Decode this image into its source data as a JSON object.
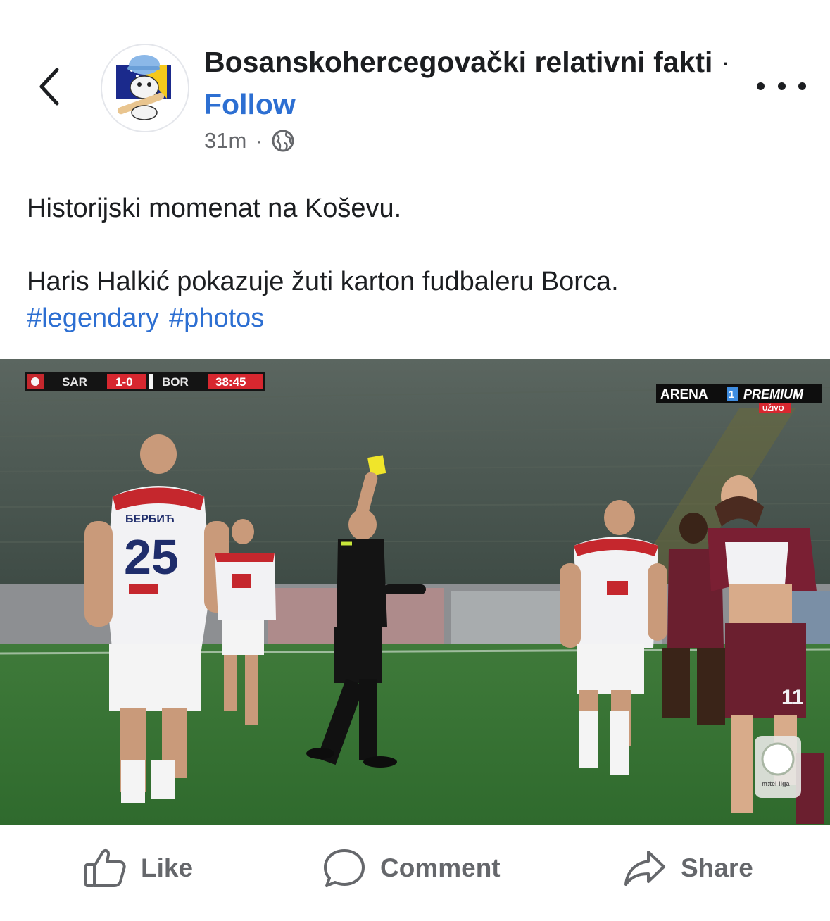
{
  "header": {
    "page_name": "Bosanskohercegovački relativni fakti",
    "separator": "·",
    "follow_label": "Follow",
    "time": "31m",
    "meta_dot": "·",
    "audience_icon": "globe-icon"
  },
  "post": {
    "line1": "Historijski momenat na Koševu.",
    "line2": "Haris Halkić pokazuje žuti karton fudbaleru Borca.",
    "hashtags": [
      "#legendary",
      "#photos"
    ]
  },
  "photo": {
    "scoreboard": {
      "home": "SAR",
      "score": "1-0",
      "away": "BOR",
      "clock": "38:45"
    },
    "broadcaster": {
      "name": "ARENA",
      "channel": "1",
      "tier": "PREMIUM",
      "live": "UŽIVO"
    },
    "player_name": "БЕРБИЋ",
    "player_number": "25",
    "league_badge": "m:tel liga"
  },
  "actions": {
    "like": "Like",
    "comment": "Comment",
    "share": "Share"
  },
  "colors": {
    "accent": "#2d6fd2",
    "text": "#1c1e21",
    "muted": "#65676b"
  }
}
